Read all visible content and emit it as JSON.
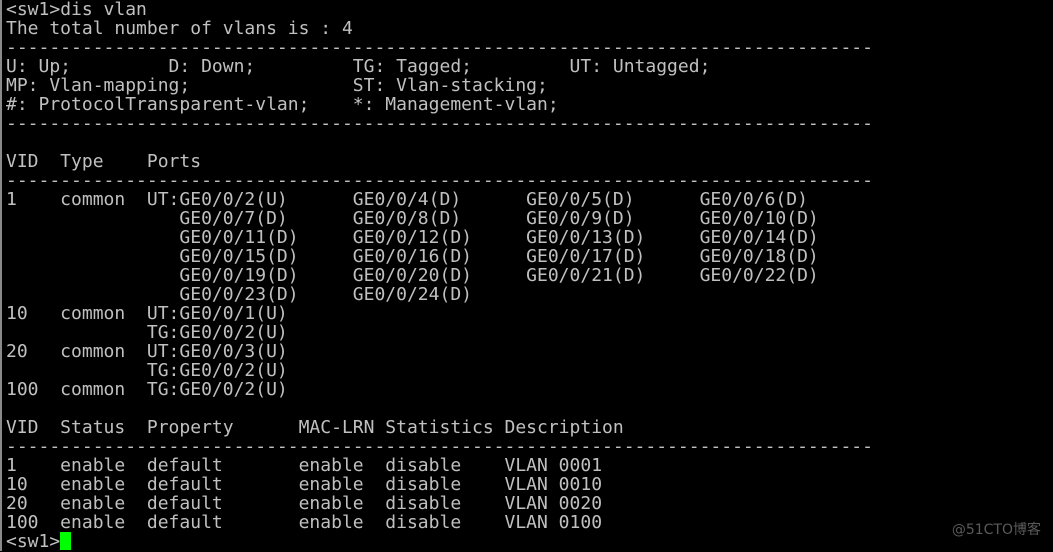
{
  "terminal": {
    "prompt": "<sw1>",
    "command": "dis vlan",
    "total_line": "The total number of vlans is : 4",
    "separator": "--------------------------------------------------------------------------------",
    "legend": [
      "U: Up;         D: Down;         TG: Tagged;         UT: Untagged;",
      "MP: Vlan-mapping;               ST: Vlan-stacking;",
      "#: ProtocolTransparent-vlan;    *: Management-vlan;"
    ],
    "ports_table": {
      "header": "VID  Type    Ports",
      "rows": [
        "1    common  UT:GE0/0/2(U)      GE0/0/4(D)      GE0/0/5(D)      GE0/0/6(D)",
        "                GE0/0/7(D)      GE0/0/8(D)      GE0/0/9(D)      GE0/0/10(D)",
        "                GE0/0/11(D)     GE0/0/12(D)     GE0/0/13(D)     GE0/0/14(D)",
        "                GE0/0/15(D)     GE0/0/16(D)     GE0/0/17(D)     GE0/0/18(D)",
        "                GE0/0/19(D)     GE0/0/20(D)     GE0/0/21(D)     GE0/0/22(D)",
        "                GE0/0/23(D)     GE0/0/24(D)",
        "10   common  UT:GE0/0/1(U)",
        "             TG:GE0/0/2(U)",
        "20   common  UT:GE0/0/3(U)",
        "             TG:GE0/0/2(U)",
        "100  common  TG:GE0/0/2(U)"
      ]
    },
    "status_table": {
      "header": "VID  Status  Property      MAC-LRN Statistics Description",
      "rows": [
        "1    enable  default       enable  disable    VLAN 0001",
        "10   enable  default       enable  disable    VLAN 0010",
        "20   enable  default       enable  disable    VLAN 0020",
        "100  enable  default       enable  disable    VLAN 0100"
      ]
    },
    "final_prompt": "<sw1>",
    "cursor_color": "#00ff00"
  },
  "watermark": "@51CTO博客"
}
